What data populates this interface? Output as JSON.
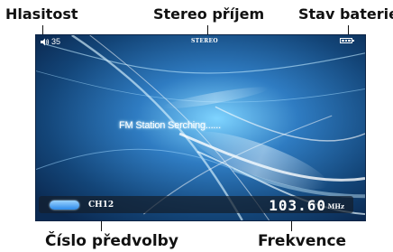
{
  "callouts": {
    "volume": "Hlasitost",
    "stereo": "Stereo příjem",
    "battery": "Stav baterie",
    "preset": "Číslo předvolby",
    "frequency": "Frekvence"
  },
  "screen": {
    "status": {
      "volume_value": "35",
      "volume_icon": "speaker-icon",
      "stereo_label": "STEREO",
      "battery_icon": "battery-icon",
      "battery_level": 1.0
    },
    "message": "FM Station Serching......",
    "bottom": {
      "preset_indicator": "preset-pill",
      "channel": "CH12",
      "frequency": "103.60",
      "unit": "MHz"
    }
  },
  "colors": {
    "background_blue": "#123a67",
    "accent_blue": "#2e8bea",
    "text": "#ffffff"
  }
}
